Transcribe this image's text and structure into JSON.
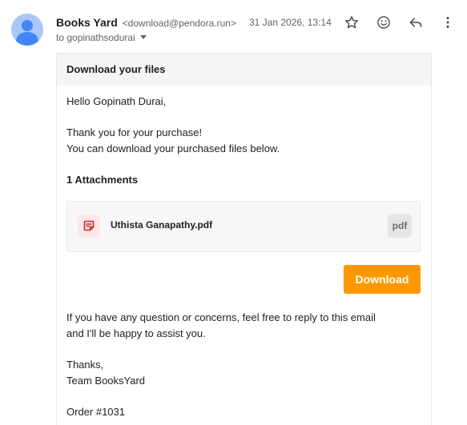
{
  "header": {
    "sender_name": "Books Yard",
    "sender_email": "<download@pendora.run>",
    "to_line": "to gopinathsodurai",
    "timestamp": "31 Jan 2026, 13:14",
    "actions": [
      "star-icon",
      "emoji-icon",
      "reply-icon",
      "more-vert-icon"
    ]
  },
  "email": {
    "title": "Download your files",
    "greeting": "Hello Gopinath Durai,",
    "thanks_line": "Thank you for your purchase!",
    "download_line": "You can download your purchased files below.",
    "attachments_heading": "1 Attachments",
    "attachment": {
      "file_name": "Uthista Ganapathy.pdf",
      "extension": "pdf",
      "icon": "file-icon"
    },
    "download_button": "Download",
    "question_line_1": "If you have any question or concerns, feel free to reply to this email",
    "question_line_2": "and I'll be happy to assist you.",
    "signoff_1": "Thanks,",
    "signoff_2": "Team BooksYard",
    "order": "Order #1031"
  },
  "colors": {
    "accent": "#ff9800",
    "avatar": "#a8c7fa",
    "avatar_figure": "#4285f4",
    "file_icon_bg": "#fde7e7",
    "file_icon": "#e53935"
  }
}
